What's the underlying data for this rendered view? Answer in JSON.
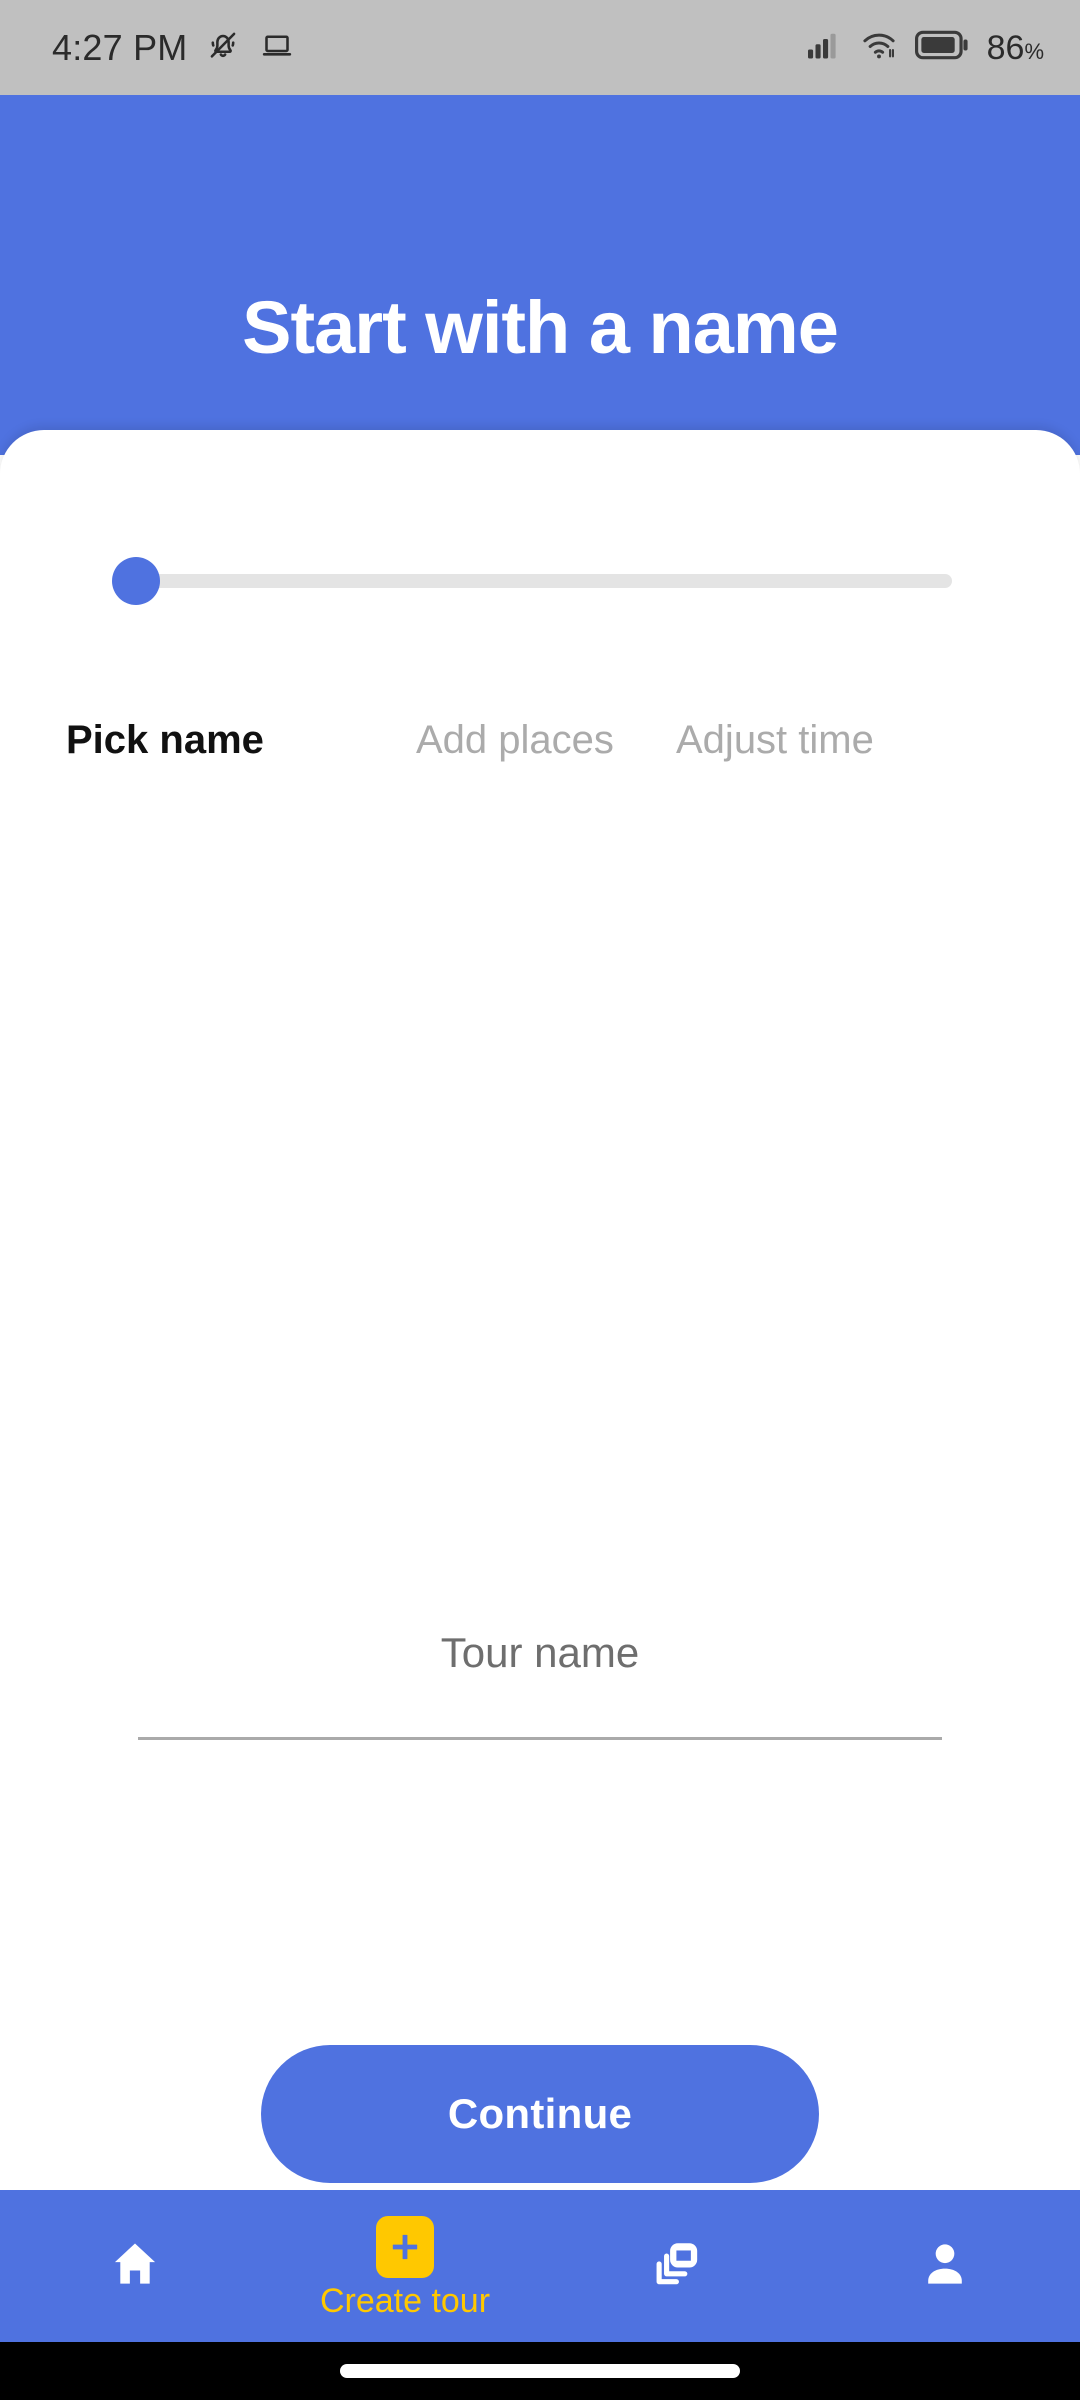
{
  "status_bar": {
    "time": "4:27 PM",
    "battery_percent": "86",
    "percent_sign": "%",
    "icons": [
      "bell-muted-icon",
      "laptop-icon",
      "signal-bars-icon",
      "wifi-icon",
      "battery-icon"
    ],
    "background_color": "#c0c0c0"
  },
  "header": {
    "title": "Start with a name",
    "background_color": "#4f72e0",
    "text_color": "#ffffff"
  },
  "progress": {
    "value": 0,
    "min": 0,
    "max": 100,
    "thumb_color": "#4f72e0",
    "track_color": "#e4e4e4",
    "steps": [
      {
        "label": "Pick name",
        "active": true
      },
      {
        "label": "Add places",
        "active": false
      },
      {
        "label": "Adjust time",
        "active": false
      }
    ]
  },
  "form": {
    "tour_name": {
      "value": "",
      "placeholder": "Tour name"
    }
  },
  "actions": {
    "continue_label": "Continue",
    "continue_color": "#4f72e0"
  },
  "bottom_nav": {
    "background_color": "#4f72e0",
    "accent_color": "#ffc800",
    "items": [
      {
        "icon": "home-icon",
        "label": "",
        "active": false
      },
      {
        "icon": "plus-icon",
        "label": "Create tour",
        "active": true
      },
      {
        "icon": "layers-icon",
        "label": "",
        "active": false
      },
      {
        "icon": "person-icon",
        "label": "",
        "active": false
      }
    ]
  }
}
